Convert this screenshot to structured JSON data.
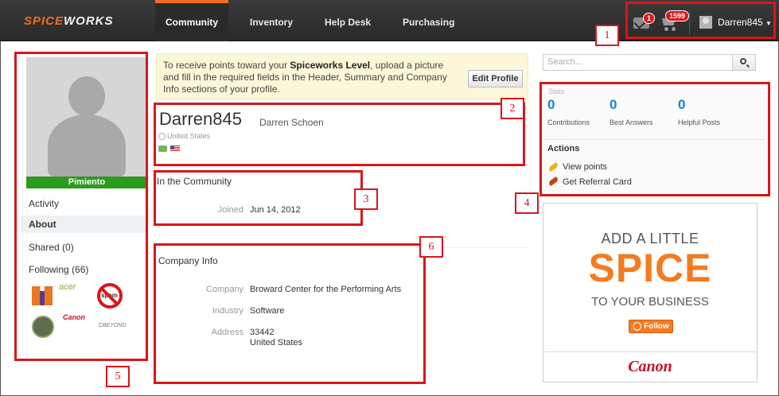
{
  "topnav": {
    "logo_prefix": "SPICE",
    "logo_suffix": "WORKS",
    "items": [
      {
        "label": "Community",
        "active": true
      },
      {
        "label": "Inventory"
      },
      {
        "label": "Help Desk"
      },
      {
        "label": "Purchasing"
      }
    ],
    "mail_badge": "1",
    "cart_badge": "1599",
    "username": "Darren845"
  },
  "annotations": [
    "1",
    "2",
    "3",
    "4",
    "5",
    "6"
  ],
  "sidebar": {
    "rank": "Pimiento",
    "links": [
      "Activity",
      "About",
      "Shared (0)",
      "Following (66)"
    ],
    "following_logos": {
      "acer": "acer",
      "spam": "spam",
      "canon": "Canon",
      "cbeyond": "CBEYOND"
    }
  },
  "notice": {
    "text_before": "To receive points toward your ",
    "text_bold": "Spiceworks Level",
    "text_after": ", upload a picture and fill in the required fields in the Header, Summary and Company Info sections of your profile.",
    "button": "Edit Profile"
  },
  "profile": {
    "username": "Darren845",
    "full_name": "Darren Schoen",
    "country": "United States"
  },
  "community": {
    "heading": "In the Community",
    "joined_label": "Joined",
    "joined_value": "Jun 14, 2012"
  },
  "company": {
    "heading": "Company Info",
    "company_label": "Company",
    "company_value": "Broward Center for the Performing Arts",
    "industry_label": "Industry",
    "industry_value": "Software",
    "address_label": "Address",
    "address_line1": "33442",
    "address_line2": "United States"
  },
  "search": {
    "placeholder": "Search..."
  },
  "stats": {
    "label": "Stats",
    "contributions": "0",
    "contributions_label": "Contributions",
    "best_answers": "0",
    "best_answers_label": "Best Answers",
    "helpful_posts": "0",
    "helpful_posts_label": "Helpful Posts"
  },
  "actions": {
    "heading": "Actions",
    "items": [
      "View points",
      "Get Referral Card"
    ]
  },
  "ad": {
    "line1": "ADD A LITTLE",
    "line2": "SPICE",
    "line3": "TO YOUR BUSINESS",
    "follow": "Follow",
    "brand": "Canon"
  },
  "colors": {
    "accent": "#f26b21",
    "annotation_red": "#d8161b",
    "stat_blue": "#1b83c4",
    "rank_green": "#2c9a1e"
  }
}
